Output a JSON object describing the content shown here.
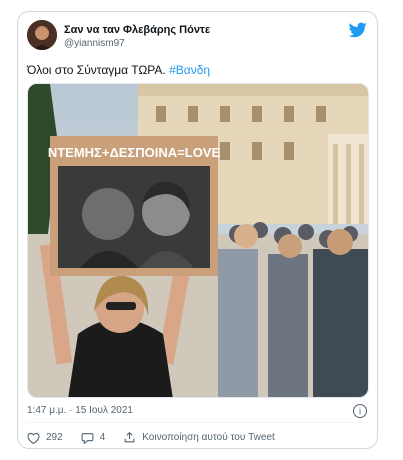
{
  "tweet": {
    "author_name": "Σαν να ταν Φλεβάρης Πόντε",
    "handle": "@yiannism97",
    "text": "Όλοι στο Σύνταγμα ΤΩΡΑ.",
    "hashtag": "#Βανδη",
    "timestamp": "1:47 μ.μ. · 15 Ιουλ 2021",
    "likes": "292",
    "replies": "4",
    "share_label": "Κοινοποίηση αυτού του Tweet"
  },
  "photo": {
    "sign_text": "ΝΤΕΜΗΣ+ΔΕΣΠΟΙΝΑ=LOVE"
  },
  "colors": {
    "accent": "#1d9bf0",
    "text": "#0f1419",
    "muted": "#536471"
  },
  "icons": [
    "twitter-bird-icon",
    "info-icon",
    "heart-icon",
    "reply-icon",
    "share-icon"
  ]
}
